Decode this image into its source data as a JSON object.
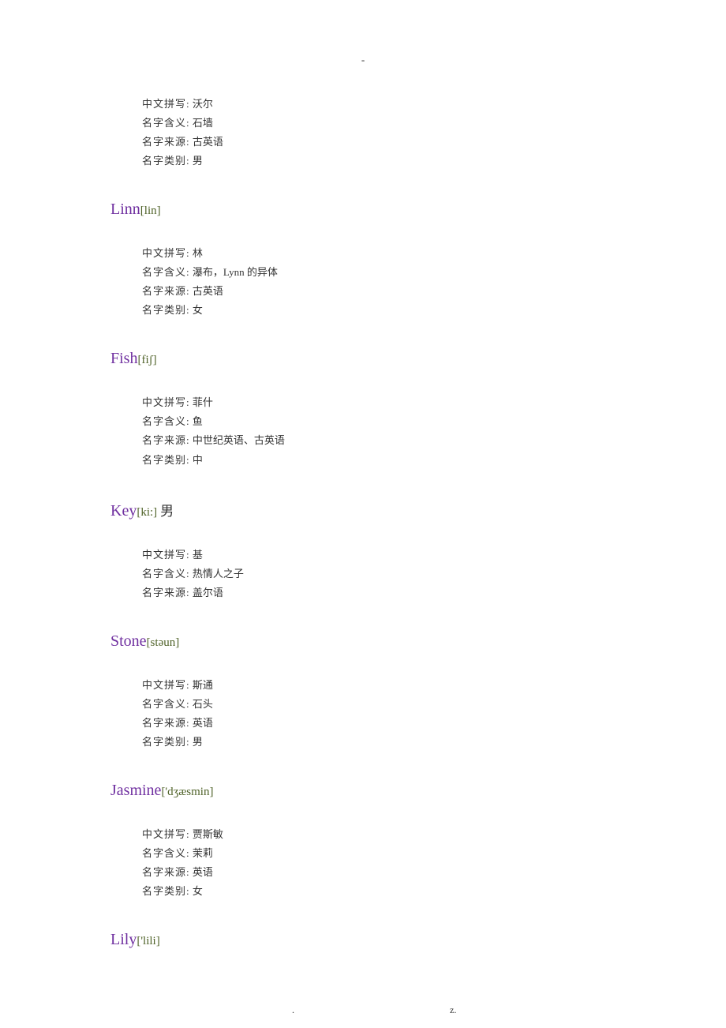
{
  "top_mark": "-",
  "labels": {
    "pinyin": "中文拼写:",
    "meaning": "名字含义:",
    "origin": "名字来源:",
    "gender": "名字类别:"
  },
  "entries": [
    {
      "name": "",
      "pron": "",
      "extra": "",
      "rows": [
        {
          "label": "中文拼写:",
          "value": "沃尔"
        },
        {
          "label": "名字含义:",
          "value": "石墙"
        },
        {
          "label": "名字来源:",
          "value": "古英语"
        },
        {
          "label": "名字类别:",
          "value": " 男"
        }
      ]
    },
    {
      "name": "Linn",
      "pron": "[lin]",
      "extra": "",
      "rows": [
        {
          "label": "中文拼写:",
          "value": "林"
        },
        {
          "label": "名字含义:",
          "value": "瀑布，Lynn 的异体"
        },
        {
          "label": "名字来源:",
          "value": "古英语"
        },
        {
          "label": "名字类别:",
          "value": "女"
        }
      ]
    },
    {
      "name": "Fish",
      "pron": "[fiʃ]",
      "extra": "",
      "rows": [
        {
          "label": "中文拼写:",
          "value": "菲什"
        },
        {
          "label": "名字含义:",
          "value": "鱼"
        },
        {
          "label": "名字来源:",
          "value": "中世纪英语、古英语"
        },
        {
          "label": "名字类别:",
          "value": "中"
        }
      ]
    },
    {
      "name": "Key",
      "pron": "[ki:]",
      "extra": "男",
      "rows": [
        {
          "label": "中文拼写:",
          "value": "基"
        },
        {
          "label": "名字含义:",
          "value": "热情人之子"
        },
        {
          "label": "名字来源:",
          "value": "盖尔语"
        }
      ]
    },
    {
      "name": "Stone",
      "pron": "[stəun]",
      "extra": "",
      "rows": [
        {
          "label": "中文拼写:",
          "value": "斯通"
        },
        {
          "label": "名字含义:",
          "value": "石头"
        },
        {
          "label": "名字来源:",
          "value": "英语"
        },
        {
          "label": "名字类别:",
          "value": " 男"
        }
      ]
    },
    {
      "name": "Jasmine",
      "pron": "['dʒæsmin]",
      "extra": "",
      "rows": [
        {
          "label": "中文拼写:",
          "value": "贾斯敏"
        },
        {
          "label": "名字含义:",
          "value": "茉莉"
        },
        {
          "label": "名字来源:",
          "value": "英语"
        },
        {
          "label": "名字类别:",
          "value": "女"
        }
      ]
    },
    {
      "name": "Lily",
      "pron": "['lili]",
      "extra": "",
      "rows": []
    }
  ],
  "footer": {
    "dot": ".",
    "z": "z."
  }
}
